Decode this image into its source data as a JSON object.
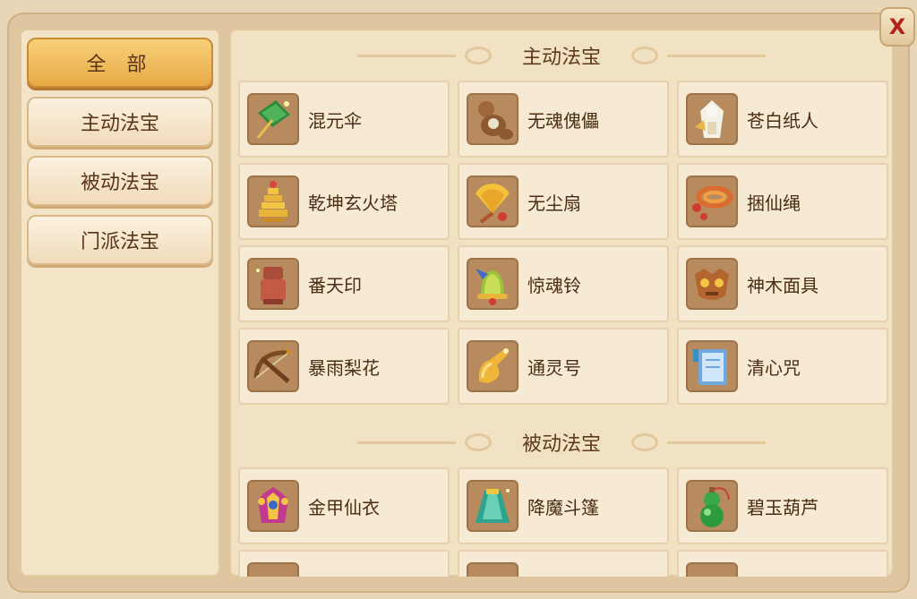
{
  "sidebar": {
    "categories": [
      {
        "label": "全 部",
        "active": true
      },
      {
        "label": "主动法宝",
        "active": false
      },
      {
        "label": "被动法宝",
        "active": false
      },
      {
        "label": "门派法宝",
        "active": false
      }
    ]
  },
  "sections": [
    {
      "title": "主动法宝",
      "items": [
        {
          "name": "混元伞",
          "icon": "umbrella-icon"
        },
        {
          "name": "无魂傀儡",
          "icon": "puppet-icon"
        },
        {
          "name": "苍白纸人",
          "icon": "paper-figure-icon"
        },
        {
          "name": "乾坤玄火塔",
          "icon": "pagoda-icon"
        },
        {
          "name": "无尘扇",
          "icon": "fan-icon"
        },
        {
          "name": "捆仙绳",
          "icon": "rope-icon"
        },
        {
          "name": "番天印",
          "icon": "seal-icon"
        },
        {
          "name": "惊魂铃",
          "icon": "bell-icon"
        },
        {
          "name": "神木面具",
          "icon": "mask-icon"
        },
        {
          "name": "暴雨梨花",
          "icon": "crossbow-icon"
        },
        {
          "name": "通灵号",
          "icon": "horn-icon"
        },
        {
          "name": "清心咒",
          "icon": "scroll-book-icon"
        }
      ]
    },
    {
      "title": "被动法宝",
      "items": [
        {
          "name": "金甲仙衣",
          "icon": "armor-icon"
        },
        {
          "name": "降魔斗篷",
          "icon": "cloak-icon"
        },
        {
          "name": "碧玉葫芦",
          "icon": "gourd-icon"
        }
      ]
    }
  ],
  "close_label": "X",
  "colors": {
    "active_tab": "#e9aa45",
    "panel_bg": "#f2e2c4",
    "card_bg": "#f7ead4",
    "text": "#4a2c12"
  }
}
